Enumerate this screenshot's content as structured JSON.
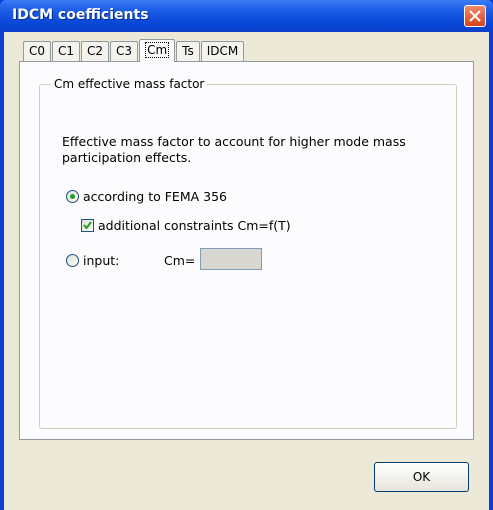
{
  "window": {
    "title": "IDCM coefficients"
  },
  "tabs": [
    {
      "label": "C0",
      "active": false
    },
    {
      "label": "C1",
      "active": false
    },
    {
      "label": "C2",
      "active": false
    },
    {
      "label": "C3",
      "active": false
    },
    {
      "label": "Cm",
      "active": true
    },
    {
      "label": "Ts",
      "active": false
    },
    {
      "label": "IDCM",
      "active": false
    }
  ],
  "group": {
    "legend": "Cm effective mass factor",
    "description": "Effective mass factor to account for higher mode mass participation effects."
  },
  "options": {
    "fema_label": "according to FEMA 356",
    "fema_selected": true,
    "constraints_label": "additional constraints Cm=f(T)",
    "constraints_checked": true,
    "input_label": "input:",
    "input_selected": false,
    "cm_label": "Cm=",
    "cm_value": ""
  },
  "buttons": {
    "ok_label": "OK"
  },
  "colors": {
    "title_bar": "#0a49d8",
    "dialog_bg": "#ece9d8",
    "panel_bg": "#fcfcfe",
    "radio_dot": "#21a121"
  }
}
